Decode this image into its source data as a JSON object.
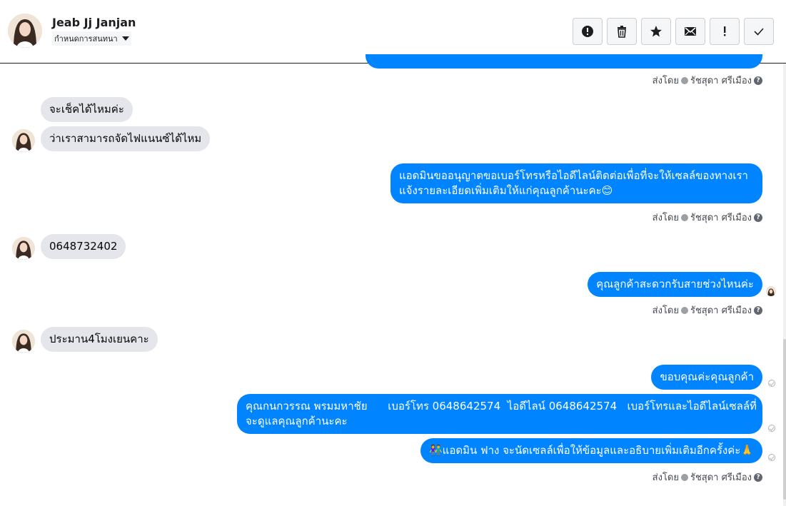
{
  "contact": {
    "name": "Jeab Jj Janjan",
    "conversation_settings": "กำหนดการสนทนา"
  },
  "actions": [
    {
      "name": "report-icon",
      "glyph": "!"
    },
    {
      "name": "trash-icon"
    },
    {
      "name": "star-icon"
    },
    {
      "name": "mail-icon"
    },
    {
      "name": "exclamation-icon",
      "glyph": "!"
    },
    {
      "name": "check-icon"
    }
  ],
  "sent_by": {
    "label": "ส่งโดย",
    "agent": "รัชสุดา ศรีเมือง",
    "help": "?"
  },
  "messages": [
    {
      "dir": "in",
      "text": "จะเช็คได้ไหมค่ะ"
    },
    {
      "dir": "in",
      "text": "ว่าเราสามารถจัดไฟแนนซ์ได้ไหม"
    },
    {
      "dir": "out",
      "line1": "แอดมินขออนุญาตขอเบอร์โทรหรือไอดีไลน์ติดต่อเพื่อที่จะให้เซลล์ของทางเรา",
      "line2": "แจ้งรายละเอียดเพิ่มเติมให้แก่คุณลูกค้านะคะ😊"
    },
    {
      "dir": "in",
      "text": "0648732402"
    },
    {
      "dir": "out",
      "text": "คุณลูกค้าสะดวกรับสายช่วงไหนค่ะ"
    },
    {
      "dir": "in",
      "text": "ประมาน4โมงเยนคาะ"
    },
    {
      "dir": "out",
      "text": "ขอบคุณค่ะคุณลูกค้า"
    },
    {
      "dir": "out",
      "line1": "คุณกนกวรรณ พรมมหาชัย      เบอร์โทร 0648642574  ไอดีไลน์ 0648642574   เบอร์โทรและไอดีไลน์เซลล์ที่",
      "line2": "จะดูแลคุณลูกค้านะคะ"
    },
    {
      "dir": "out",
      "text": "👫แอดมิน ฟาง จะนัดเซลล์เพื่อให้ข้อมูลและอธิบายเพิ่มเติมอีกครั้งค่ะ🙏"
    }
  ],
  "colors": {
    "outgoing": "#0084ff",
    "incoming": "#e4e6eb"
  }
}
